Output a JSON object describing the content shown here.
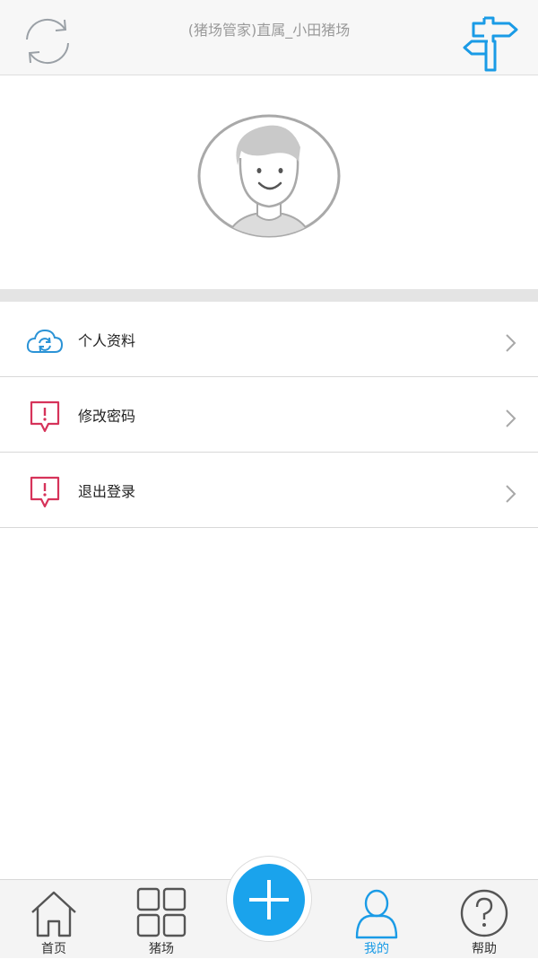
{
  "header": {
    "title": "(猪场管家)直属_小田猪场",
    "left_icon": "refresh-icon",
    "right_icon": "signpost-icon"
  },
  "profile": {
    "avatar_icon": "user-avatar-icon"
  },
  "menu": {
    "items": [
      {
        "label": "个人资料",
        "icon": "cloud-sync-icon",
        "color": "#2b93d6"
      },
      {
        "label": "修改密码",
        "icon": "alert-icon",
        "color": "#d6335a"
      },
      {
        "label": "退出登录",
        "icon": "alert-icon",
        "color": "#d6335a"
      }
    ]
  },
  "tabbar": {
    "tabs": [
      {
        "label": "首页",
        "icon": "home-icon"
      },
      {
        "label": "猪场",
        "icon": "grid-icon"
      },
      {
        "label": "",
        "icon": "plus-icon"
      },
      {
        "label": "我的",
        "icon": "user-icon",
        "active": true
      },
      {
        "label": "帮助",
        "icon": "help-icon"
      }
    ]
  },
  "colors": {
    "accent": "#1aa3ec",
    "alert": "#d6335a",
    "header_bg": "#f7f7f7"
  }
}
